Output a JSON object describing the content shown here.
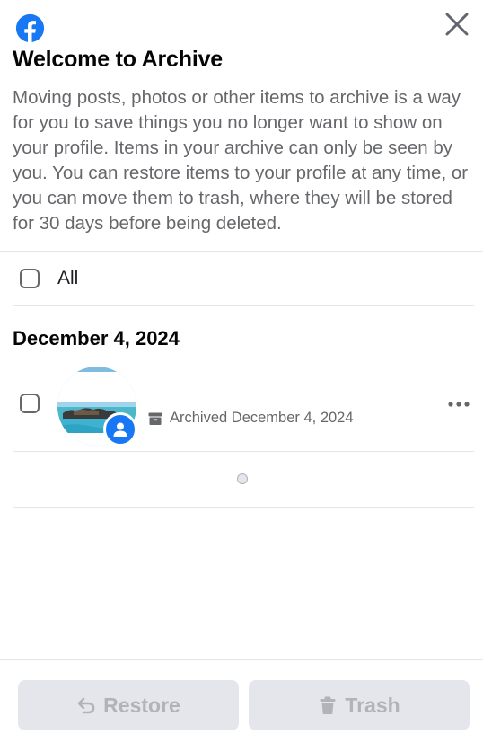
{
  "header": {
    "logo_icon": "facebook-logo-icon",
    "close_icon": "close-icon",
    "title": "Welcome to Archive",
    "description": "Moving posts, photos or other items to archive is a way for you to save things you no longer want to show on your profile. Items in your archive can only be seen by you. You can restore items to your profile at any time, or you can move them to trash, where they will be stored for 30 days before being deleted."
  },
  "select_all": {
    "label": "All",
    "checked": false
  },
  "groups": [
    {
      "date": "December 4, 2024",
      "items": [
        {
          "checked": false,
          "status": "Archived December 4, 2024",
          "thumbnail": "beach-photo",
          "badge_icon": "profile-icon",
          "status_icon": "archive-box-icon",
          "menu_icon": "more-options-icon"
        }
      ]
    }
  ],
  "footer": {
    "restore_label": "Restore",
    "restore_icon": "undo-icon",
    "trash_label": "Trash",
    "trash_icon": "trash-icon"
  },
  "colors": {
    "brand": "#1877f2",
    "text_primary": "#050505",
    "text_secondary": "#65676b",
    "disabled_button_bg": "#e4e6eb",
    "disabled_button_text": "#b0b3b8",
    "divider": "#e4e6eb"
  }
}
